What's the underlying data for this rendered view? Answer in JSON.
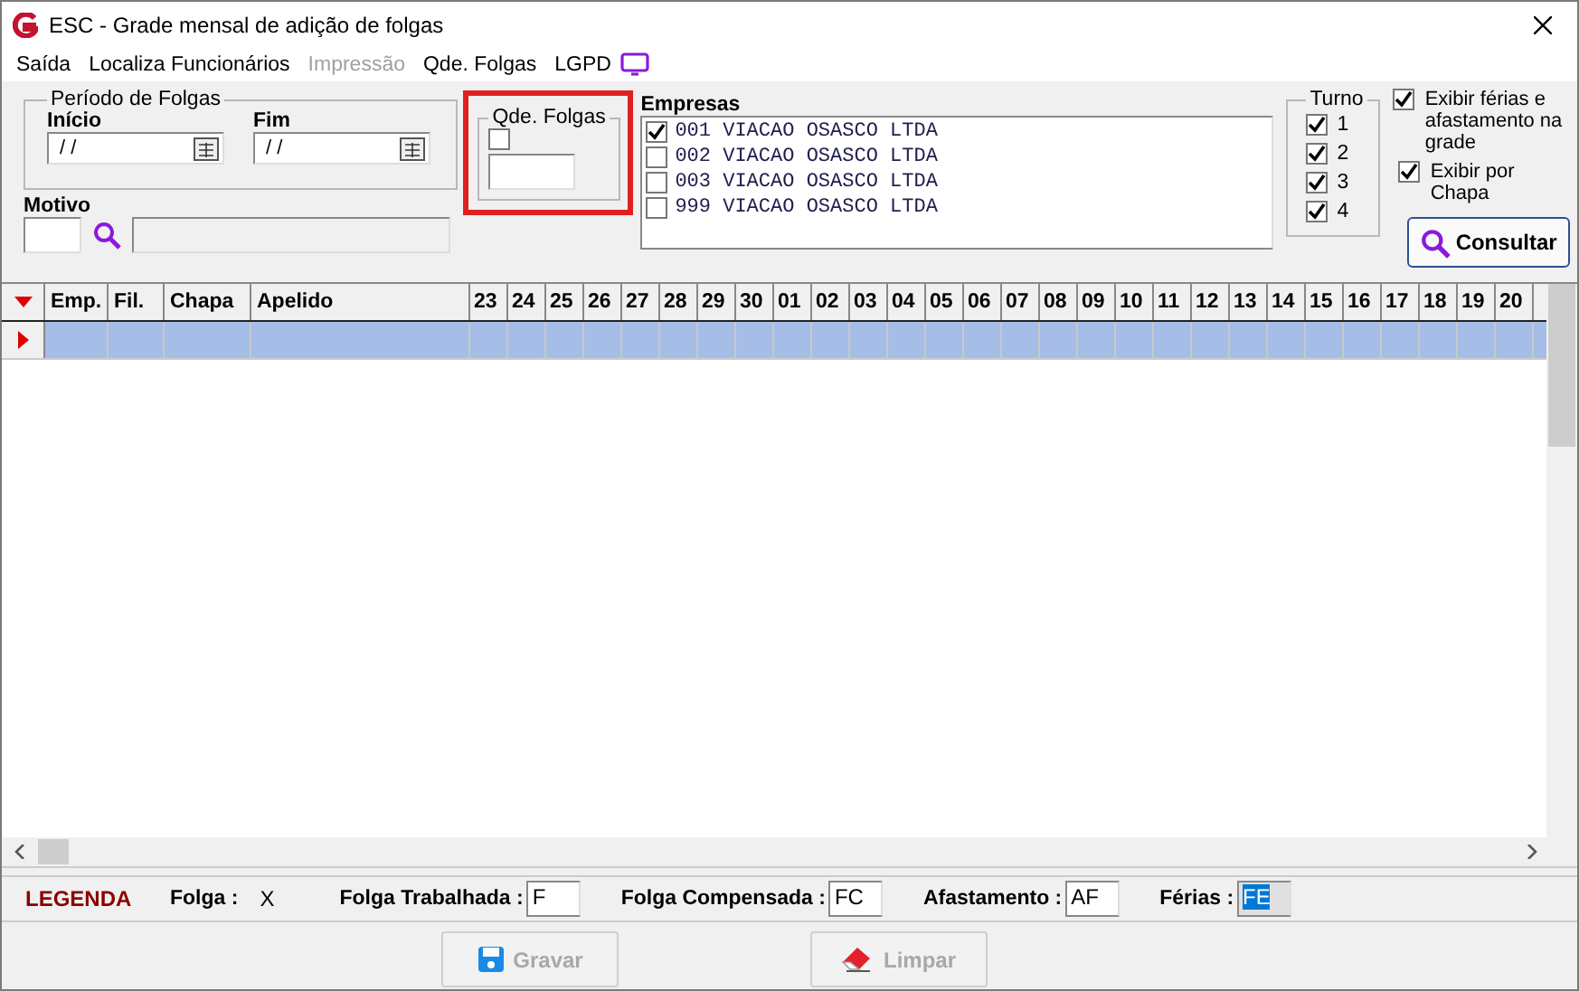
{
  "window": {
    "title": "ESC - Grade mensal de adição de folgas"
  },
  "menu": [
    {
      "label": "Saída",
      "disabled": false
    },
    {
      "label": "Localiza Funcionários",
      "disabled": false
    },
    {
      "label": "Impressão",
      "disabled": true
    },
    {
      "label": "Qde. Folgas",
      "disabled": false
    },
    {
      "label": "LGPD",
      "disabled": false
    }
  ],
  "period": {
    "title": "Período de Folgas",
    "start": {
      "label": "Início",
      "value": " / /"
    },
    "end": {
      "label": "Fim",
      "value": " / /"
    }
  },
  "motivo": {
    "label": "Motivo"
  },
  "qde_folgas": {
    "title": "Qde. Folgas",
    "checked": false,
    "highlighted": true
  },
  "empresas": {
    "label": "Empresas",
    "items": [
      {
        "label": "001 VIACAO OSASCO LTDA",
        "checked": true
      },
      {
        "label": "002 VIACAO OSASCO LTDA",
        "checked": false
      },
      {
        "label": "003 VIACAO OSASCO LTDA",
        "checked": false
      },
      {
        "label": "999 VIACAO OSASCO LTDA",
        "checked": false
      }
    ]
  },
  "turno": {
    "title": "Turno",
    "items": [
      {
        "label": "1",
        "checked": true
      },
      {
        "label": "2",
        "checked": true
      },
      {
        "label": "3",
        "checked": true
      },
      {
        "label": "4",
        "checked": true
      }
    ]
  },
  "options": [
    {
      "label": "Exibir férias e afastamento na grade",
      "checked": true
    },
    {
      "label": "Exibir por Chapa",
      "checked": true
    }
  ],
  "consultar_button": {
    "label": "Consultar"
  },
  "grid": {
    "columns": [
      "Emp.",
      "Fil.",
      "Chapa",
      "Apelido",
      "23",
      "24",
      "25",
      "26",
      "27",
      "28",
      "29",
      "30",
      "01",
      "02",
      "03",
      "04",
      "05",
      "06",
      "07",
      "08",
      "09",
      "10",
      "11",
      "12",
      "13",
      "14",
      "15",
      "16",
      "17",
      "18",
      "19",
      "20"
    ],
    "rows": [
      {
        "selected": true
      }
    ]
  },
  "legend": {
    "title": "LEGENDA",
    "items": [
      {
        "kind": "text",
        "label": "Folga :",
        "value": "X"
      },
      {
        "kind": "field",
        "label": "Folga Trabalhada :",
        "value": "F"
      },
      {
        "kind": "field",
        "label": "Folga Compensada :",
        "value": "FC"
      },
      {
        "kind": "field",
        "label": "Afastamento :",
        "value": "AF"
      },
      {
        "kind": "focused",
        "label": "Férias :",
        "value": "FE"
      }
    ]
  },
  "buttons": [
    {
      "kind": "save",
      "label": "Gravar",
      "disabled": true
    },
    {
      "kind": "clear",
      "label": "Limpar",
      "disabled": true
    }
  ]
}
